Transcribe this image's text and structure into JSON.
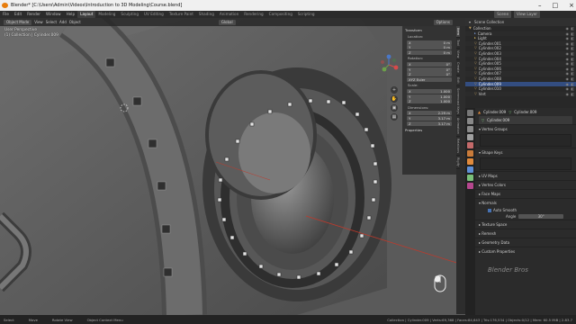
{
  "window": {
    "title": "Blender* [C:\\Users\\Admin\\Videos\\Introduction to 3D Modeling\\Course.blend]",
    "controls": [
      "–",
      "□",
      "×"
    ]
  },
  "menu": [
    "File",
    "Edit",
    "Render",
    "Window",
    "Help"
  ],
  "workspaces": [
    "Layout",
    "Modeling",
    "Sculpting",
    "UV Editing",
    "Texture Paint",
    "Shading",
    "Animation",
    "Rendering",
    "Compositing",
    "Scripting"
  ],
  "active_workspace": "Layout",
  "scene": {
    "label": "Scene",
    "view_layer": "View Layer"
  },
  "viewport": {
    "header": [
      "Object Mode",
      "View",
      "Select",
      "Add",
      "Object"
    ],
    "transform_orientation": "Global",
    "options": "Options",
    "overlay_line1": "User Perspective",
    "overlay_line2": "(1) Collection | Cylinder.009"
  },
  "npanel": {
    "transform": "Transform",
    "location": "Location:",
    "loc": [
      {
        "axis": "X",
        "val": "0 m"
      },
      {
        "axis": "Y",
        "val": "0 m"
      },
      {
        "axis": "Z",
        "val": "0 m"
      }
    ],
    "rotation": "Rotation:",
    "rot": [
      {
        "axis": "X",
        "val": "0°"
      },
      {
        "axis": "Y",
        "val": "0°"
      },
      {
        "axis": "Z",
        "val": "0°"
      }
    ],
    "euler": "XYZ Euler",
    "scale": "Scale:",
    "scl": [
      {
        "axis": "X",
        "val": "1.000"
      },
      {
        "axis": "Y",
        "val": "1.000"
      },
      {
        "axis": "Z",
        "val": "1.000"
      }
    ],
    "dimensions": "Dimensions:",
    "dim": [
      {
        "axis": "X",
        "val": "2.29 m"
      },
      {
        "axis": "Y",
        "val": "3.17 m"
      },
      {
        "axis": "Z",
        "val": "3.17 m"
      }
    ],
    "properties": "Properties",
    "tabs": [
      "Item",
      "Tool",
      "View",
      "Create",
      "Edit",
      "Screencast Keys",
      "Animation",
      "Relations",
      "Rigify"
    ]
  },
  "outliner": {
    "header": "Scene Collection",
    "items": [
      "Collection",
      "Camera",
      "Light",
      "Cylinder.001",
      "Cylinder.002",
      "Cylinder.003",
      "Cylinder.004",
      "Cylinder.005",
      "Cylinder.006",
      "Cylinder.007",
      "Cylinder.008",
      "Cylinder.009",
      "Cylinder.010",
      "Vert"
    ]
  },
  "properties": {
    "object": "Cylinder.009",
    "mesh": "Cylinder.009",
    "datablock": "Cylinder.009",
    "sections": [
      "Vertex Groups",
      "Shape Keys",
      "UV Maps",
      "Vertex Colors",
      "Face Maps",
      "Normals"
    ],
    "auto_smooth": "Auto Smooth",
    "angle_label": "Angle",
    "angle_value": "30°",
    "sections2": [
      "Texture Space",
      "Remesh",
      "Geometry Data",
      "Custom Properties"
    ]
  },
  "status": {
    "select": "Select",
    "move": "Move",
    "rotate": "Rotate View",
    "context": "Object Context Menu",
    "stats": "Collection | Cylinder.009 | Verts:69,368 | Faces:84,643 | Tris:176,534 | Objects:0/12 | Mem: 60.5 MiB | 2.83.7"
  },
  "watermark": "Blender Bros",
  "colors": {
    "accent": "#4772b3",
    "orange": "#e87d0d",
    "viewport_bg": "#5a5a5a"
  }
}
